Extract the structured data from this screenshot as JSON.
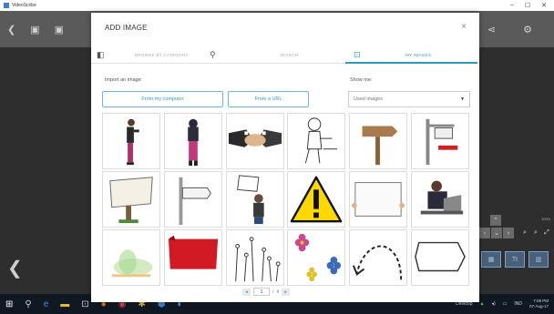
{
  "window": {
    "title": "VideoScribe",
    "controls": [
      "–",
      "☐",
      "✕"
    ]
  },
  "modal": {
    "title": "ADD IMAGE",
    "close": "×",
    "tabs": [
      {
        "label": "BROWSE BY CATEGORY"
      },
      {
        "label": "SEARCH"
      },
      {
        "label": "MY IMAGES",
        "active": true
      }
    ],
    "import_label": "Import an image:",
    "from_computer": "From my computer",
    "from_url": "From a URL",
    "show_me_label": "Show me:",
    "show_me_value": "Used images",
    "images": [
      "person-standing-side",
      "woman-hijab-standing",
      "handshake",
      "person-at-desk-sketch",
      "wooden-signpost",
      "hanging-sign-post",
      "blank-wooden-sign",
      "arrow-signpost",
      "man-holding-sign",
      "warning-sign",
      "blank-paper",
      "man-at-laptop",
      "green-watercolor-splash",
      "red-banner",
      "drawn-flower-stems",
      "colorful-flowers",
      "dashed-curved-arrow",
      "hexagon-outline"
    ],
    "pager": {
      "page": "1",
      "of": "/",
      "total": "4"
    }
  },
  "taskbar": {
    "desktop_label": "Desktop",
    "lang": "IND",
    "time": "7:08 PM",
    "date": "07-Aug-17"
  },
  "side_panel": {
    "zoom": "100%"
  },
  "colors": {
    "accent": "#2d9bb8",
    "toolbar": "#5a5a5a",
    "taskbar": "#101923"
  }
}
